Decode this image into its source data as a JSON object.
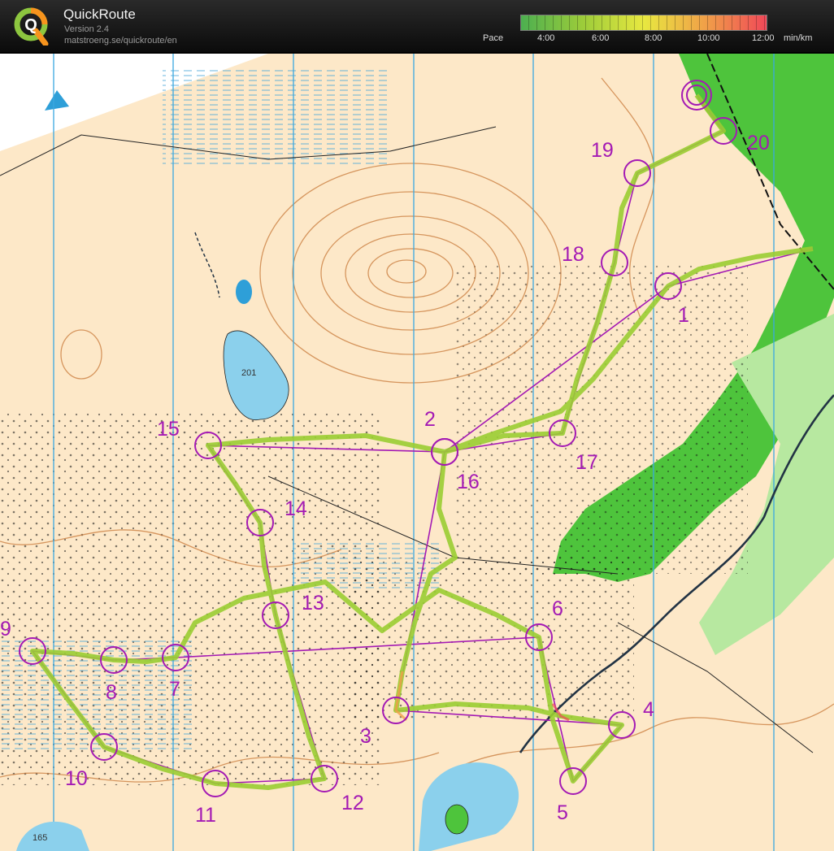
{
  "header": {
    "app_name": "QuickRoute",
    "version": "Version 2.4",
    "url": "matstroeng.se/quickroute/en",
    "logo_letter": "Q"
  },
  "pace_scale": {
    "label": "Pace",
    "ticks": [
      "4:00",
      "6:00",
      "8:00",
      "10:00",
      "12:00"
    ],
    "unit": "min/km",
    "colors": [
      "#4caf50",
      "#9ccc3a",
      "#e8e840",
      "#f0a048",
      "#f04858"
    ]
  },
  "map": {
    "background_color": "#fde8c8",
    "course_color": "#a41ab4",
    "route_color": "#9acd32",
    "lake_labels": [
      "201",
      "165"
    ],
    "controls": [
      {
        "label": "1"
      },
      {
        "label": "2"
      },
      {
        "label": "3"
      },
      {
        "label": "4"
      },
      {
        "label": "5"
      },
      {
        "label": "6"
      },
      {
        "label": "7"
      },
      {
        "label": "8"
      },
      {
        "label": "9"
      },
      {
        "label": "10"
      },
      {
        "label": "11"
      },
      {
        "label": "12"
      },
      {
        "label": "13"
      },
      {
        "label": "14"
      },
      {
        "label": "15"
      },
      {
        "label": "16"
      },
      {
        "label": "17"
      },
      {
        "label": "18"
      },
      {
        "label": "19"
      },
      {
        "label": "20"
      }
    ]
  }
}
